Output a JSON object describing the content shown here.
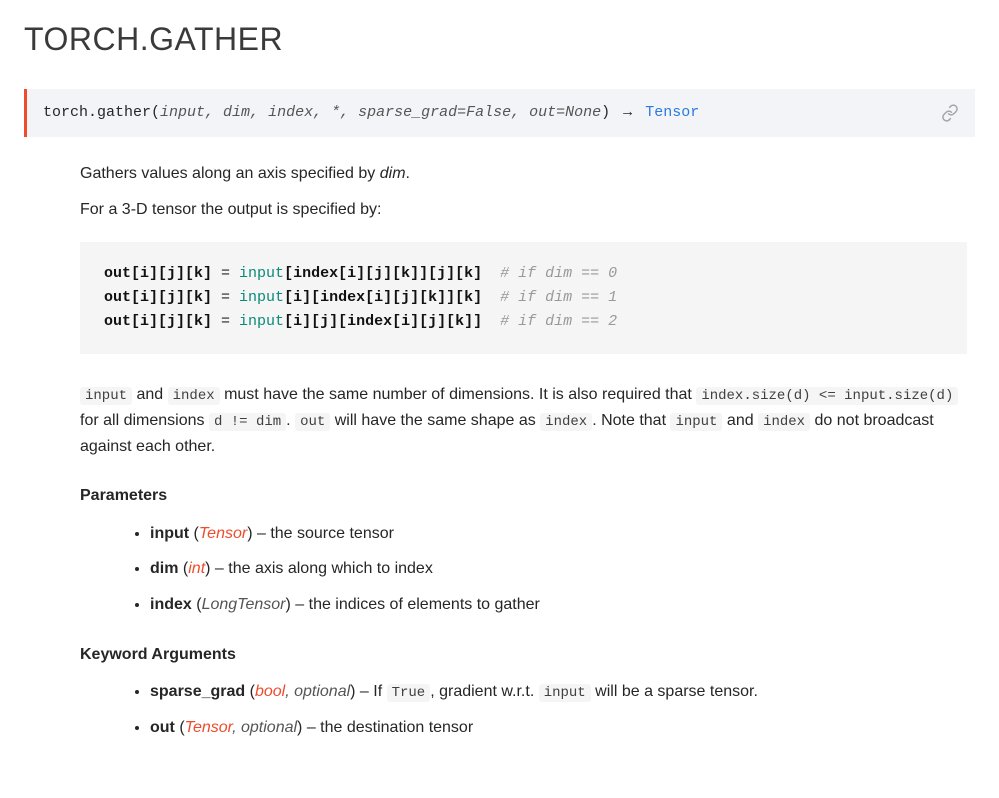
{
  "title": "TORCH.GATHER",
  "signature": {
    "funcname": "torch.gather",
    "open": "(",
    "close": ")",
    "params": "input, dim, index, *, sparse_grad=False, out=None",
    "arrow": "→",
    "returns": "Tensor"
  },
  "intro": {
    "p1_pre": "Gathers values along an axis specified by ",
    "p1_em": "dim",
    "p1_post": ".",
    "p2": "For a 3-D tensor the output is specified by:"
  },
  "code": {
    "l1_a": "out[i][j][k]",
    "l1_eq": " = ",
    "l1_b": "input",
    "l1_c": "[index[i][j][k]][j][k]",
    "l1_pad": "  ",
    "l1_cm": "# if dim == 0",
    "l2_a": "out[i][j][k]",
    "l2_eq": " = ",
    "l2_b": "input",
    "l2_c": "[i][index[i][j][k]][k]",
    "l2_pad": "  ",
    "l2_cm": "# if dim == 1",
    "l3_a": "out[i][j][k]",
    "l3_eq": " = ",
    "l3_b": "input",
    "l3_c": "[i][j][index[i][j][k]]",
    "l3_pad": "  ",
    "l3_cm": "# if dim == 2"
  },
  "note": {
    "c_input": "input",
    "t1": " and ",
    "c_index": "index",
    "t2": " must have the same number of dimensions. It is also required that ",
    "c_sizecmp": "index.size(d) <= input.size(d)",
    "t3": " for all dimensions ",
    "c_dne": "d != dim",
    "t4": ". ",
    "c_out": "out",
    "t5": " will have the same shape as ",
    "c_index2": "index",
    "t6": ". Note that ",
    "c_input2": "input",
    "t7": " and ",
    "c_index3": "index",
    "t8": " do not broadcast against each other."
  },
  "sections": {
    "params_label": "Parameters",
    "kwargs_label": "Keyword Arguments"
  },
  "params": {
    "input": {
      "name": "input",
      "type": "Tensor",
      "desc": " – the source tensor"
    },
    "dim": {
      "name": "dim",
      "type": "int",
      "desc": " – the axis along which to index"
    },
    "index": {
      "name": "index",
      "type": "LongTensor",
      "desc": " – the indices of elements to gather"
    }
  },
  "kwargs": {
    "sparse_grad": {
      "name": "sparse_grad",
      "type": "bool",
      "optional": ", optional",
      "desc_pre": " – If ",
      "desc_code": "True",
      "desc_mid": ", gradient w.r.t. ",
      "desc_code2": "input",
      "desc_post": " will be a sparse tensor."
    },
    "out": {
      "name": "out",
      "type": "Tensor",
      "optional": ", optional",
      "desc": " – the destination tensor"
    }
  },
  "punct": {
    "open": " (",
    "close": ")"
  }
}
